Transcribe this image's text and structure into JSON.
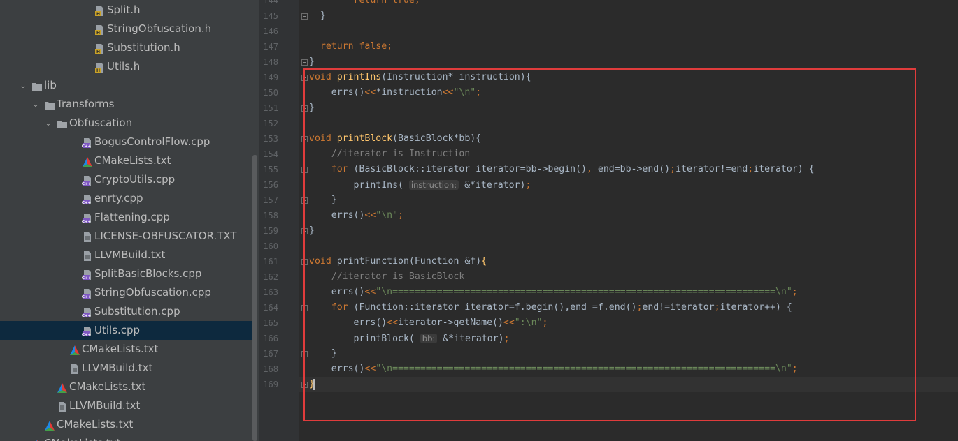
{
  "project_tree": [
    {
      "label": "Split.h",
      "depth": 7,
      "type": "header"
    },
    {
      "label": "StringObfuscation.h",
      "depth": 7,
      "type": "header"
    },
    {
      "label": "Substitution.h",
      "depth": 7,
      "type": "header"
    },
    {
      "label": "Utils.h",
      "depth": 7,
      "type": "header"
    },
    {
      "label": "lib",
      "depth": 2,
      "type": "folder",
      "expanded": true
    },
    {
      "label": "Transforms",
      "depth": 3,
      "type": "folder",
      "expanded": true
    },
    {
      "label": "Obfuscation",
      "depth": 4,
      "type": "folder",
      "expanded": true
    },
    {
      "label": "BogusControlFlow.cpp",
      "depth": 6,
      "type": "cpp"
    },
    {
      "label": "CMakeLists.txt",
      "depth": 6,
      "type": "cmake"
    },
    {
      "label": "CryptoUtils.cpp",
      "depth": 6,
      "type": "cpp"
    },
    {
      "label": "enrty.cpp",
      "depth": 6,
      "type": "cpp"
    },
    {
      "label": "Flattening.cpp",
      "depth": 6,
      "type": "cpp"
    },
    {
      "label": "LICENSE-OBFUSCATOR.TXT",
      "depth": 6,
      "type": "text"
    },
    {
      "label": "LLVMBuild.txt",
      "depth": 6,
      "type": "text"
    },
    {
      "label": "SplitBasicBlocks.cpp",
      "depth": 6,
      "type": "cpp"
    },
    {
      "label": "StringObfuscation.cpp",
      "depth": 6,
      "type": "cpp"
    },
    {
      "label": "Substitution.cpp",
      "depth": 6,
      "type": "cpp"
    },
    {
      "label": "Utils.cpp",
      "depth": 6,
      "type": "cpp",
      "selected": true
    },
    {
      "label": "CMakeLists.txt",
      "depth": 5,
      "type": "cmake"
    },
    {
      "label": "LLVMBuild.txt",
      "depth": 5,
      "type": "text"
    },
    {
      "label": "CMakeLists.txt",
      "depth": 4,
      "type": "cmake"
    },
    {
      "label": "LLVMBuild.txt",
      "depth": 4,
      "type": "text"
    },
    {
      "label": "CMakeLists.txt",
      "depth": 3,
      "type": "cmake"
    },
    {
      "label": "CMakeLists.txt",
      "depth": 2,
      "type": "cmake"
    }
  ],
  "editor": {
    "current_line": "169",
    "lines": [
      {
        "n": "144",
        "tokens": [
          {
            "t": "        ",
            "c": ""
          },
          {
            "t": "return true;",
            "c": "kw"
          }
        ]
      },
      {
        "n": "145",
        "fold": true,
        "tokens": [
          {
            "t": "  }",
            "c": ""
          }
        ]
      },
      {
        "n": "146",
        "tokens": []
      },
      {
        "n": "147",
        "tokens": [
          {
            "t": "  ",
            "c": ""
          },
          {
            "t": "return false",
            "c": "kw"
          },
          {
            "t": ";",
            "c": "kw"
          }
        ]
      },
      {
        "n": "148",
        "fold": true,
        "tokens": [
          {
            "t": "}",
            "c": ""
          }
        ]
      },
      {
        "n": "149",
        "fold": true,
        "tokens": [
          {
            "t": "void ",
            "c": "kw"
          },
          {
            "t": "printIns",
            "c": "fn"
          },
          {
            "t": "(Instruction* instruction){",
            "c": ""
          }
        ]
      },
      {
        "n": "150",
        "tokens": [
          {
            "t": "    errs()",
            "c": ""
          },
          {
            "t": "<<",
            "c": "kw"
          },
          {
            "t": "*instruction",
            "c": ""
          },
          {
            "t": "<<",
            "c": "kw"
          },
          {
            "t": "\"\\n\"",
            "c": "st"
          },
          {
            "t": ";",
            "c": "kw"
          }
        ]
      },
      {
        "n": "151",
        "fold": true,
        "tokens": [
          {
            "t": "}",
            "c": ""
          }
        ]
      },
      {
        "n": "152",
        "tokens": []
      },
      {
        "n": "153",
        "fold": true,
        "tokens": [
          {
            "t": "void ",
            "c": "kw"
          },
          {
            "t": "printBlock",
            "c": "fn"
          },
          {
            "t": "(BasicBlock*bb){",
            "c": ""
          }
        ]
      },
      {
        "n": "154",
        "tokens": [
          {
            "t": "    //iterator is Instruction",
            "c": "cm"
          }
        ]
      },
      {
        "n": "155",
        "fold": true,
        "tokens": [
          {
            "t": "    ",
            "c": ""
          },
          {
            "t": "for ",
            "c": "kw"
          },
          {
            "t": "(BasicBlock::iterator iterator=bb->begin()",
            "c": ""
          },
          {
            "t": ", ",
            "c": "kw"
          },
          {
            "t": "end=bb->end()",
            "c": ""
          },
          {
            "t": ";",
            "c": "kw"
          },
          {
            "t": "iterator!=end",
            "c": ""
          },
          {
            "t": ";",
            "c": "kw"
          },
          {
            "t": "iterator) {",
            "c": ""
          }
        ]
      },
      {
        "n": "156",
        "tokens": [
          {
            "t": "        printIns( ",
            "c": ""
          },
          {
            "t": "instruction:",
            "c": "hint"
          },
          {
            "t": " &*iterator)",
            "c": ""
          },
          {
            "t": ";",
            "c": "kw"
          }
        ]
      },
      {
        "n": "157",
        "fold": true,
        "tokens": [
          {
            "t": "    }",
            "c": ""
          }
        ]
      },
      {
        "n": "158",
        "tokens": [
          {
            "t": "    errs()",
            "c": ""
          },
          {
            "t": "<<",
            "c": "kw"
          },
          {
            "t": "\"\\n\"",
            "c": "st"
          },
          {
            "t": ";",
            "c": "kw"
          }
        ]
      },
      {
        "n": "159",
        "fold": true,
        "tokens": [
          {
            "t": "}",
            "c": ""
          }
        ]
      },
      {
        "n": "160",
        "tokens": []
      },
      {
        "n": "161",
        "fold": true,
        "tokens": [
          {
            "t": "void ",
            "c": "kw"
          },
          {
            "t": "printFunction",
            "c": ""
          },
          {
            "t": "(Function &f)",
            "c": ""
          },
          {
            "t": "{",
            "c": "fn"
          }
        ]
      },
      {
        "n": "162",
        "tokens": [
          {
            "t": "    //iterator is BasicBlock",
            "c": "cm"
          }
        ]
      },
      {
        "n": "163",
        "tokens": [
          {
            "t": "    errs()",
            "c": ""
          },
          {
            "t": "<<",
            "c": "kw"
          },
          {
            "t": "\"\\n=====================================================================\\n\"",
            "c": "st"
          },
          {
            "t": ";",
            "c": "kw"
          }
        ]
      },
      {
        "n": "164",
        "fold": true,
        "tokens": [
          {
            "t": "    ",
            "c": ""
          },
          {
            "t": "for",
            "c": "kw"
          },
          {
            "t": " (Function::iterator iterator=f.begin(),end =f.end()",
            "c": ""
          },
          {
            "t": ";",
            "c": "kw"
          },
          {
            "t": "end!=iterator",
            "c": ""
          },
          {
            "t": ";",
            "c": "kw"
          },
          {
            "t": "iterator++) {",
            "c": ""
          }
        ]
      },
      {
        "n": "165",
        "tokens": [
          {
            "t": "        errs()",
            "c": ""
          },
          {
            "t": "<<",
            "c": "kw"
          },
          {
            "t": "iterator->getName()",
            "c": ""
          },
          {
            "t": "<<",
            "c": "kw"
          },
          {
            "t": "\":\\n\"",
            "c": "st"
          },
          {
            "t": ";",
            "c": "kw"
          }
        ]
      },
      {
        "n": "166",
        "tokens": [
          {
            "t": "        printBlock( ",
            "c": ""
          },
          {
            "t": "bb:",
            "c": "hint"
          },
          {
            "t": " &*iterator)",
            "c": ""
          },
          {
            "t": ";",
            "c": "kw"
          }
        ]
      },
      {
        "n": "167",
        "fold": true,
        "tokens": [
          {
            "t": "    }",
            "c": ""
          }
        ]
      },
      {
        "n": "168",
        "tokens": [
          {
            "t": "    errs()",
            "c": ""
          },
          {
            "t": "<<",
            "c": "kw"
          },
          {
            "t": "\"\\n=====================================================================\\n\"",
            "c": "st"
          },
          {
            "t": ";",
            "c": "kw"
          }
        ]
      },
      {
        "n": "169",
        "fold": true,
        "tokens": [
          {
            "t": "}",
            "c": "fn"
          }
        ]
      }
    ]
  },
  "colors": {
    "keyword": "#cc7832",
    "function": "#ffc66d",
    "comment": "#808080",
    "string": "#6a8759",
    "text": "#a9b7c6",
    "highlight_box": "#e03c3c",
    "selection": "#0d293e"
  }
}
